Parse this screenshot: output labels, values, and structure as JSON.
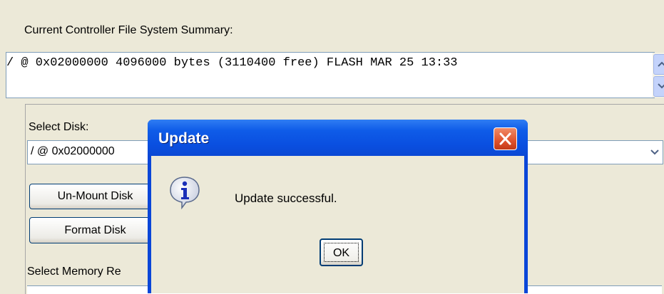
{
  "summary": {
    "label": "Current Controller File System Summary:",
    "line": "/ @ 0x02000000 4096000 bytes (3110400 free) FLASH MAR 25 13:33"
  },
  "disk": {
    "label": "Select Disk:",
    "selected": "/ @ 0x02000000"
  },
  "buttons": {
    "unmount": "Un-Mount Disk",
    "format": "Format Disk"
  },
  "memory": {
    "label": "Select Memory Re"
  },
  "dialog": {
    "title": "Update",
    "message": "Update successful.",
    "ok_label": "OK"
  },
  "icons": {
    "close": "close-icon",
    "info": "info-icon",
    "scroll_up": "scroll-up-arrow-icon",
    "scroll_down": "scroll-down-arrow-icon",
    "dropdown": "chevron-down-icon"
  },
  "colors": {
    "titlebar": "#0a4fe0",
    "close": "#e1522c",
    "background": "#ece9d8"
  }
}
